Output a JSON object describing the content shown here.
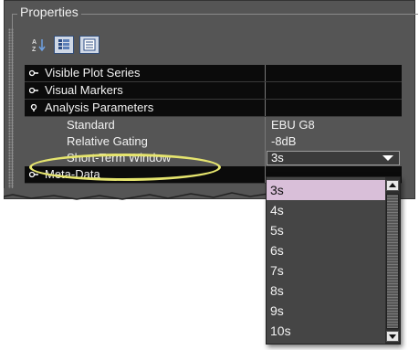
{
  "panel": {
    "title": "Properties"
  },
  "toolbar": {
    "sort_icon": "sort-az-icon",
    "categorized_icon": "categorized-view-icon",
    "list_icon": "list-view-icon"
  },
  "properties": {
    "categories": [
      {
        "label": "Visible Plot Series",
        "expanded": false
      },
      {
        "label": "Visual Markers",
        "expanded": false
      },
      {
        "label": "Analysis Parameters",
        "expanded": true
      },
      {
        "label": "Meta-Data",
        "expanded": false
      }
    ],
    "analysis_parameters": {
      "standard": {
        "label": "Standard",
        "value": "EBU G8"
      },
      "relative_gating": {
        "label": "Relative Gating",
        "value": "-8dB"
      },
      "short_term_window": {
        "label": "Short-Term Window",
        "value": "3s"
      }
    }
  },
  "dropdown": {
    "options": [
      "3s",
      "4s",
      "5s",
      "6s",
      "7s",
      "8s",
      "9s",
      "10s"
    ],
    "selected": "3s"
  },
  "colors": {
    "highlight": "#e6e56e",
    "selected_option": "#d9bfd9",
    "category_row": "#0b0b0b",
    "panel_bg": "#555555"
  }
}
